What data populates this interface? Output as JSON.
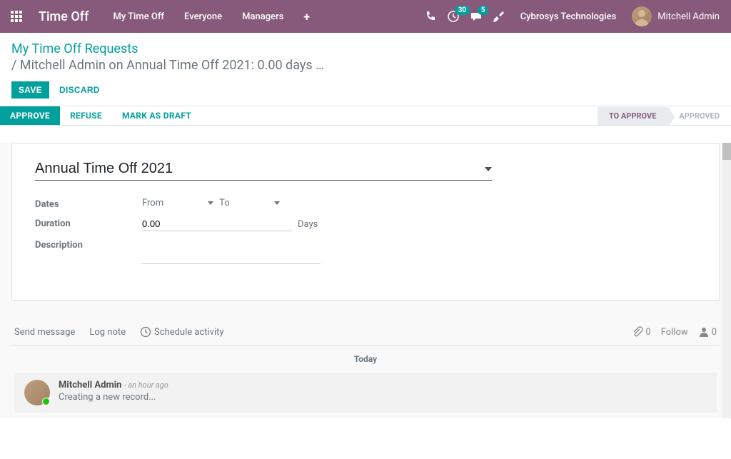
{
  "navbar": {
    "brand": "Time Off",
    "menu": [
      "My Time Off",
      "Everyone",
      "Managers"
    ],
    "activity_count": "30",
    "message_count": "5",
    "company": "Cybrosys Technologies",
    "user": "Mitchell Admin"
  },
  "breadcrumb": {
    "level1": "My Time Off Requests",
    "level2": "/  Mitchell Admin on Annual Time Off 2021: 0.00 days …"
  },
  "actions": {
    "save": "Save",
    "discard": "Discard"
  },
  "status_buttons": {
    "approve": "Approve",
    "refuse": "Refuse",
    "mark_draft": "Mark as Draft"
  },
  "status_steps": {
    "to_approve": "To Approve",
    "approved": "Approved"
  },
  "form": {
    "type_value": "Annual Time Off 2021",
    "dates_label": "Dates",
    "from_label": "From",
    "to_label": "To",
    "duration_label": "Duration",
    "duration_value": "0.00",
    "days_label": "Days",
    "description_label": "Description"
  },
  "chatter": {
    "send_message": "Send message",
    "log_note": "Log note",
    "schedule_activity": "Schedule activity",
    "attachment_count": "0",
    "follow": "Follow",
    "follower_count": "0",
    "today": "Today",
    "msg_author": "Mitchell Admin",
    "msg_time": "- an hour ago",
    "msg_body": "Creating a new record..."
  }
}
